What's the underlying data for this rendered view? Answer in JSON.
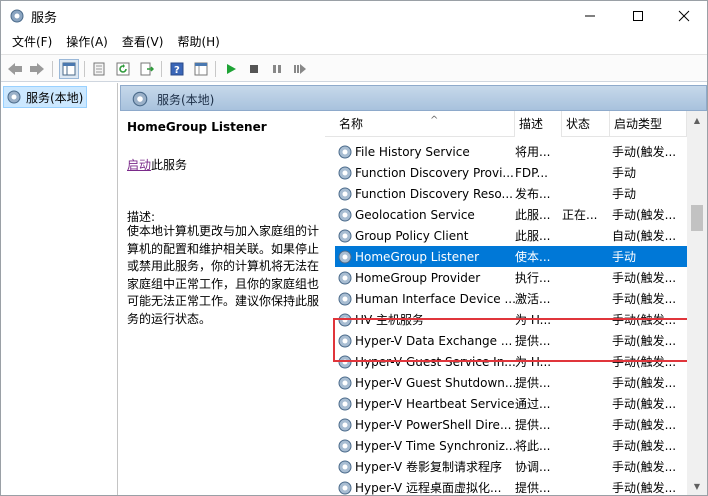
{
  "window": {
    "title": "服务"
  },
  "menu": [
    "文件(F)",
    "操作(A)",
    "查看(V)",
    "帮助(H)"
  ],
  "tree": {
    "label": "服务(本地)"
  },
  "pane": {
    "header": "服务(本地)",
    "service_title": "HomeGroup Listener",
    "start_link": "启动",
    "start_suffix": "此服务",
    "desc_label": "描述:",
    "desc_text": "使本地计算机更改与加入家庭组的计算机的配置和维护相关联。如果停止或禁用此服务，你的计算机将无法在家庭组中正常工作，且你的家庭组也可能无法正常工作。建议你保持此服务的运行状态。"
  },
  "list": {
    "columns": {
      "name": "名称",
      "desc": "描述",
      "status": "状态",
      "start": "启动类型"
    },
    "rows": [
      {
        "name": "File History Service",
        "desc": "将用...",
        "status": "",
        "start": "手动(触发..."
      },
      {
        "name": "Function Discovery Provi...",
        "desc": "FDP...",
        "status": "",
        "start": "手动"
      },
      {
        "name": "Function Discovery Reso...",
        "desc": "发布...",
        "status": "",
        "start": "手动"
      },
      {
        "name": "Geolocation Service",
        "desc": "此服...",
        "status": "正在...",
        "start": "手动(触发..."
      },
      {
        "name": "Group Policy Client",
        "desc": "此服...",
        "status": "",
        "start": "自动(触发..."
      },
      {
        "name": "HomeGroup Listener",
        "desc": "使本...",
        "status": "",
        "start": "手动",
        "selected": true
      },
      {
        "name": "HomeGroup Provider",
        "desc": "执行...",
        "status": "",
        "start": "手动(触发..."
      },
      {
        "name": "Human Interface Device ...",
        "desc": "激活...",
        "status": "",
        "start": "手动(触发..."
      },
      {
        "name": "HV 主机服务",
        "desc": "为 H...",
        "status": "",
        "start": "手动(触发..."
      },
      {
        "name": "Hyper-V Data Exchange ...",
        "desc": "提供...",
        "status": "",
        "start": "手动(触发..."
      },
      {
        "name": "Hyper-V Guest Service In...",
        "desc": "为 H...",
        "status": "",
        "start": "手动(触发..."
      },
      {
        "name": "Hyper-V Guest Shutdown...",
        "desc": "提供...",
        "status": "",
        "start": "手动(触发..."
      },
      {
        "name": "Hyper-V Heartbeat Service",
        "desc": "通过...",
        "status": "",
        "start": "手动(触发..."
      },
      {
        "name": "Hyper-V PowerShell Dire...",
        "desc": "提供...",
        "status": "",
        "start": "手动(触发..."
      },
      {
        "name": "Hyper-V Time Synchroniz...",
        "desc": "将此...",
        "status": "",
        "start": "手动(触发..."
      },
      {
        "name": "Hyper-V 卷影复制请求程序",
        "desc": "协调...",
        "status": "",
        "start": "手动(触发..."
      },
      {
        "name": "Hyper-V 远程桌面虚拟化...",
        "desc": "提供...",
        "status": "",
        "start": "手动(触发..."
      }
    ]
  },
  "colors": {
    "selection": "#0078d7",
    "highlight_border": "#e0353b",
    "header_bg": "#b8cde4"
  }
}
